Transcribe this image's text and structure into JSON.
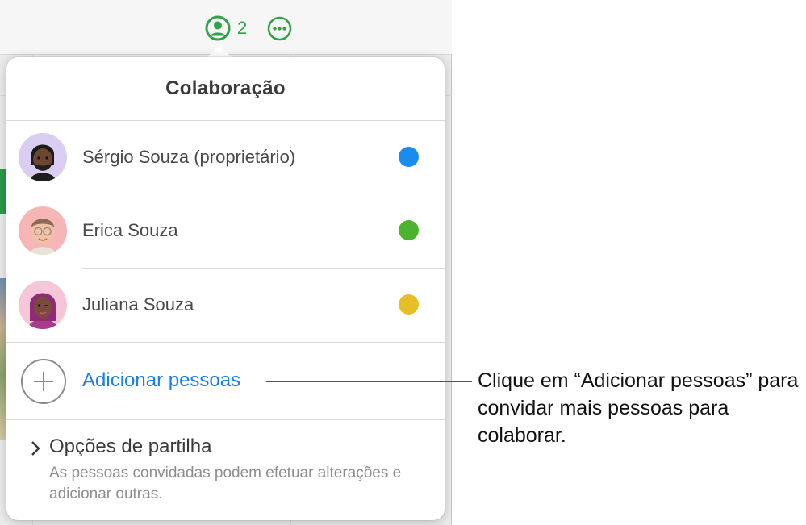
{
  "toolbar": {
    "collaborator_count": "2",
    "collaborate_icon": "person-circle-icon",
    "more_icon": "ellipsis-circle-icon",
    "accent_color": "#2fa24a"
  },
  "popover": {
    "title": "Colaboração",
    "people": [
      {
        "name": "Sérgio Souza (proprietário)",
        "color": "#1a8cf0",
        "avatar_icon": "memoji-avatar"
      },
      {
        "name": "Erica Souza",
        "color": "#4cb32f",
        "avatar_icon": "memoji-avatar"
      },
      {
        "name": "Juliana Souza",
        "color": "#e6be25",
        "avatar_icon": "memoji-avatar"
      }
    ],
    "add_people": {
      "label": "Adicionar pessoas",
      "icon": "plus-circle-icon",
      "color": "#1a7ee8"
    },
    "sharing_options": {
      "title": "Opções de partilha",
      "description": "As pessoas convidadas podem efetuar alterações e adicionar outras.",
      "icon": "chevron-right-icon"
    }
  },
  "callout": {
    "text": "Clique em “Adicionar pessoas” para convidar mais pessoas para colaborar."
  }
}
